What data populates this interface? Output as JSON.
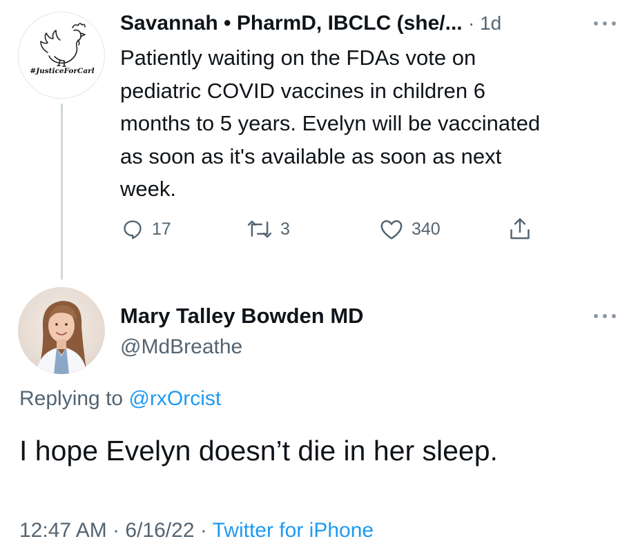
{
  "parent_tweet": {
    "avatar_text": "#JusticeForCarl",
    "name": "Savannah • PharmD, IBCLC (she/...",
    "time": "· 1d",
    "more_icon": "more-horizontal-icon",
    "body_lines": [
      "Patiently waiting on the FDAs vote on",
      "pediatric COVID vaccines in children 6",
      "months to 5 years. Evelyn will be vaccinated",
      "as soon as it's available as soon as next",
      "week."
    ],
    "actions": {
      "reply_icon": "reply-icon",
      "reply_count": "17",
      "retweet_icon": "retweet-icon",
      "retweet_count": "3",
      "like_icon": "heart-icon",
      "like_count": "340",
      "share_icon": "share-icon"
    }
  },
  "reply_tweet": {
    "name": "Mary Talley Bowden MD",
    "handle": "@MdBreathe",
    "more_icon": "more-horizontal-icon",
    "replying_to_prefix": "Replying to ",
    "replying_to_mention": "@rxOrcist",
    "body": "I hope Evelyn doesn’t die in her sleep.",
    "timestamp": "12:47 AM · 6/16/22 · ",
    "source": "Twitter for iPhone"
  },
  "colors": {
    "text_primary": "#0f1419",
    "text_secondary": "#536471",
    "link_blue": "#1d9bf0",
    "thread_line": "#cfd9de"
  }
}
